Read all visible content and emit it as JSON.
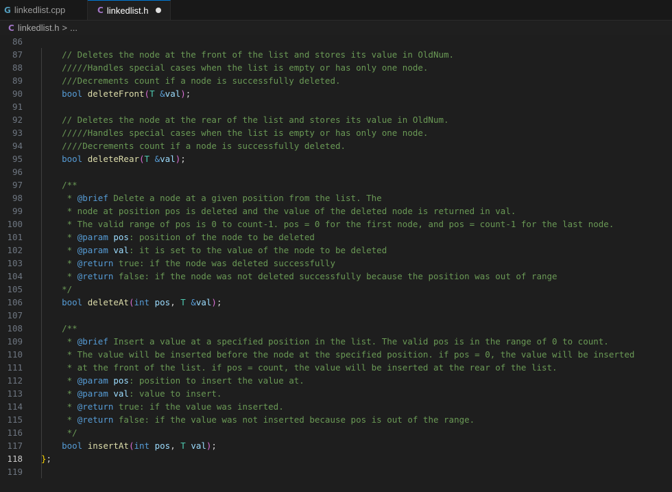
{
  "tabs": [
    {
      "icon": "G",
      "label": "linkedlist.cpp",
      "active": false
    },
    {
      "icon": "C",
      "label": "linkedlist.h",
      "active": true,
      "modified": true
    }
  ],
  "breadcrumb": {
    "icon": "C",
    "file": "linkedlist.h",
    "separator": ">",
    "rest": "..."
  },
  "lines": [
    {
      "n": "86",
      "t": []
    },
    {
      "n": "87",
      "t": [
        [
          "    ",
          ""
        ],
        [
          "// Deletes the node at the front of the list and stores its value in OldNum.",
          "cm"
        ]
      ]
    },
    {
      "n": "88",
      "t": [
        [
          "    ",
          ""
        ],
        [
          "/////Handles special cases when the list is empty or has only one node.",
          "cm"
        ]
      ]
    },
    {
      "n": "89",
      "t": [
        [
          "    ",
          ""
        ],
        [
          "///Decrements count if a node is successfully deleted.",
          "cm"
        ]
      ]
    },
    {
      "n": "90",
      "t": [
        [
          "    ",
          ""
        ],
        [
          "bool",
          "kw"
        ],
        [
          " ",
          ""
        ],
        [
          "deleteFront",
          "fn"
        ],
        [
          "(",
          "br2"
        ],
        [
          "T",
          "tp"
        ],
        [
          " ",
          ""
        ],
        [
          "&",
          "kw"
        ],
        [
          "val",
          "pm"
        ],
        [
          ")",
          "br2"
        ],
        [
          ";",
          "op"
        ]
      ]
    },
    {
      "n": "91",
      "t": []
    },
    {
      "n": "92",
      "t": [
        [
          "    ",
          ""
        ],
        [
          "// Deletes the node at the rear of the list and stores its value in OldNum.",
          "cm"
        ]
      ]
    },
    {
      "n": "93",
      "t": [
        [
          "    ",
          ""
        ],
        [
          "/////Handles special cases when the list is empty or has only one node.",
          "cm"
        ]
      ]
    },
    {
      "n": "94",
      "t": [
        [
          "    ",
          ""
        ],
        [
          "////Decrements count if a node is successfully deleted.",
          "cm"
        ]
      ]
    },
    {
      "n": "95",
      "t": [
        [
          "    ",
          ""
        ],
        [
          "bool",
          "kw"
        ],
        [
          " ",
          ""
        ],
        [
          "deleteRear",
          "fn"
        ],
        [
          "(",
          "br2"
        ],
        [
          "T",
          "tp"
        ],
        [
          " ",
          ""
        ],
        [
          "&",
          "kw"
        ],
        [
          "val",
          "pm"
        ],
        [
          ")",
          "br2"
        ],
        [
          ";",
          "op"
        ]
      ]
    },
    {
      "n": "96",
      "t": []
    },
    {
      "n": "97",
      "t": [
        [
          "    ",
          ""
        ],
        [
          "/**",
          "cm"
        ]
      ]
    },
    {
      "n": "98",
      "t": [
        [
          "    ",
          ""
        ],
        [
          " * ",
          "cm"
        ],
        [
          "@brief",
          "tag"
        ],
        [
          " Delete a node at a given position from the list. The",
          "cm"
        ]
      ]
    },
    {
      "n": "99",
      "t": [
        [
          "    ",
          ""
        ],
        [
          " * node at position pos is deleted and the value of the deleted node is returned in val.",
          "cm"
        ]
      ]
    },
    {
      "n": "100",
      "t": [
        [
          "    ",
          ""
        ],
        [
          " * The valid range of pos is 0 to count-1. pos = 0 for the first node, and pos = count-1 for the last node.",
          "cm"
        ]
      ]
    },
    {
      "n": "101",
      "t": [
        [
          "    ",
          ""
        ],
        [
          " * ",
          "cm"
        ],
        [
          "@param",
          "tag"
        ],
        [
          " ",
          "cm"
        ],
        [
          "pos",
          "doc"
        ],
        [
          ": position of the node to be deleted",
          "cm"
        ]
      ]
    },
    {
      "n": "102",
      "t": [
        [
          "    ",
          ""
        ],
        [
          " * ",
          "cm"
        ],
        [
          "@param",
          "tag"
        ],
        [
          " ",
          "cm"
        ],
        [
          "val",
          "doc"
        ],
        [
          ": it is set to the value of the node to be deleted",
          "cm"
        ]
      ]
    },
    {
      "n": "103",
      "t": [
        [
          "    ",
          ""
        ],
        [
          " * ",
          "cm"
        ],
        [
          "@return",
          "tag"
        ],
        [
          " true: if the node was deleted successfully",
          "cm"
        ]
      ]
    },
    {
      "n": "104",
      "t": [
        [
          "    ",
          ""
        ],
        [
          " * ",
          "cm"
        ],
        [
          "@return",
          "tag"
        ],
        [
          " false: if the node was not deleted successfully because the position was out of range",
          "cm"
        ]
      ]
    },
    {
      "n": "105",
      "t": [
        [
          "    ",
          ""
        ],
        [
          "*/",
          "cm"
        ]
      ]
    },
    {
      "n": "106",
      "t": [
        [
          "    ",
          ""
        ],
        [
          "bool",
          "kw"
        ],
        [
          " ",
          ""
        ],
        [
          "deleteAt",
          "fn"
        ],
        [
          "(",
          "br2"
        ],
        [
          "int",
          "kw"
        ],
        [
          " ",
          ""
        ],
        [
          "pos",
          "pm"
        ],
        [
          ", ",
          "op"
        ],
        [
          "T",
          "tp"
        ],
        [
          " ",
          ""
        ],
        [
          "&",
          "kw"
        ],
        [
          "val",
          "pm"
        ],
        [
          ")",
          "br2"
        ],
        [
          ";",
          "op"
        ]
      ]
    },
    {
      "n": "107",
      "t": []
    },
    {
      "n": "108",
      "t": [
        [
          "    ",
          ""
        ],
        [
          "/**",
          "cm"
        ]
      ]
    },
    {
      "n": "109",
      "t": [
        [
          "    ",
          ""
        ],
        [
          " * ",
          "cm"
        ],
        [
          "@brief",
          "tag"
        ],
        [
          " Insert a value at a specified position in the list. The valid pos is in the range of 0 to count.",
          "cm"
        ]
      ]
    },
    {
      "n": "110",
      "t": [
        [
          "    ",
          ""
        ],
        [
          " * The value will be inserted before the node at the specified position. if pos = 0, the value will be inserted",
          "cm"
        ]
      ]
    },
    {
      "n": "111",
      "t": [
        [
          "    ",
          ""
        ],
        [
          " * at the front of the list. if pos = count, the value will be inserted at the rear of the list.",
          "cm"
        ]
      ]
    },
    {
      "n": "112",
      "t": [
        [
          "    ",
          ""
        ],
        [
          " * ",
          "cm"
        ],
        [
          "@param",
          "tag"
        ],
        [
          " ",
          "cm"
        ],
        [
          "pos",
          "doc"
        ],
        [
          ": position to insert the value at.",
          "cm"
        ]
      ]
    },
    {
      "n": "113",
      "t": [
        [
          "    ",
          ""
        ],
        [
          " * ",
          "cm"
        ],
        [
          "@param",
          "tag"
        ],
        [
          " ",
          "cm"
        ],
        [
          "val",
          "doc"
        ],
        [
          ": value to insert.",
          "cm"
        ]
      ]
    },
    {
      "n": "114",
      "t": [
        [
          "    ",
          ""
        ],
        [
          " * ",
          "cm"
        ],
        [
          "@return",
          "tag"
        ],
        [
          " true: if the value was inserted.",
          "cm"
        ]
      ]
    },
    {
      "n": "115",
      "t": [
        [
          "    ",
          ""
        ],
        [
          " * ",
          "cm"
        ],
        [
          "@return",
          "tag"
        ],
        [
          " false: if the value was not inserted because pos is out of the range.",
          "cm"
        ]
      ]
    },
    {
      "n": "116",
      "t": [
        [
          "    ",
          ""
        ],
        [
          " */",
          "cm"
        ]
      ]
    },
    {
      "n": "117",
      "t": [
        [
          "    ",
          ""
        ],
        [
          "bool",
          "kw"
        ],
        [
          " ",
          ""
        ],
        [
          "insertAt",
          "fn"
        ],
        [
          "(",
          "br2"
        ],
        [
          "int",
          "kw"
        ],
        [
          " ",
          ""
        ],
        [
          "pos",
          "pm"
        ],
        [
          ", ",
          "op"
        ],
        [
          "T",
          "tp"
        ],
        [
          " ",
          ""
        ],
        [
          "val",
          "pm"
        ],
        [
          ")",
          "br2"
        ],
        [
          ";",
          "op"
        ]
      ]
    },
    {
      "n": "118",
      "t": [
        [
          "}",
          "br"
        ],
        [
          ";",
          "op"
        ]
      ]
    },
    {
      "n": "119",
      "t": []
    }
  ]
}
